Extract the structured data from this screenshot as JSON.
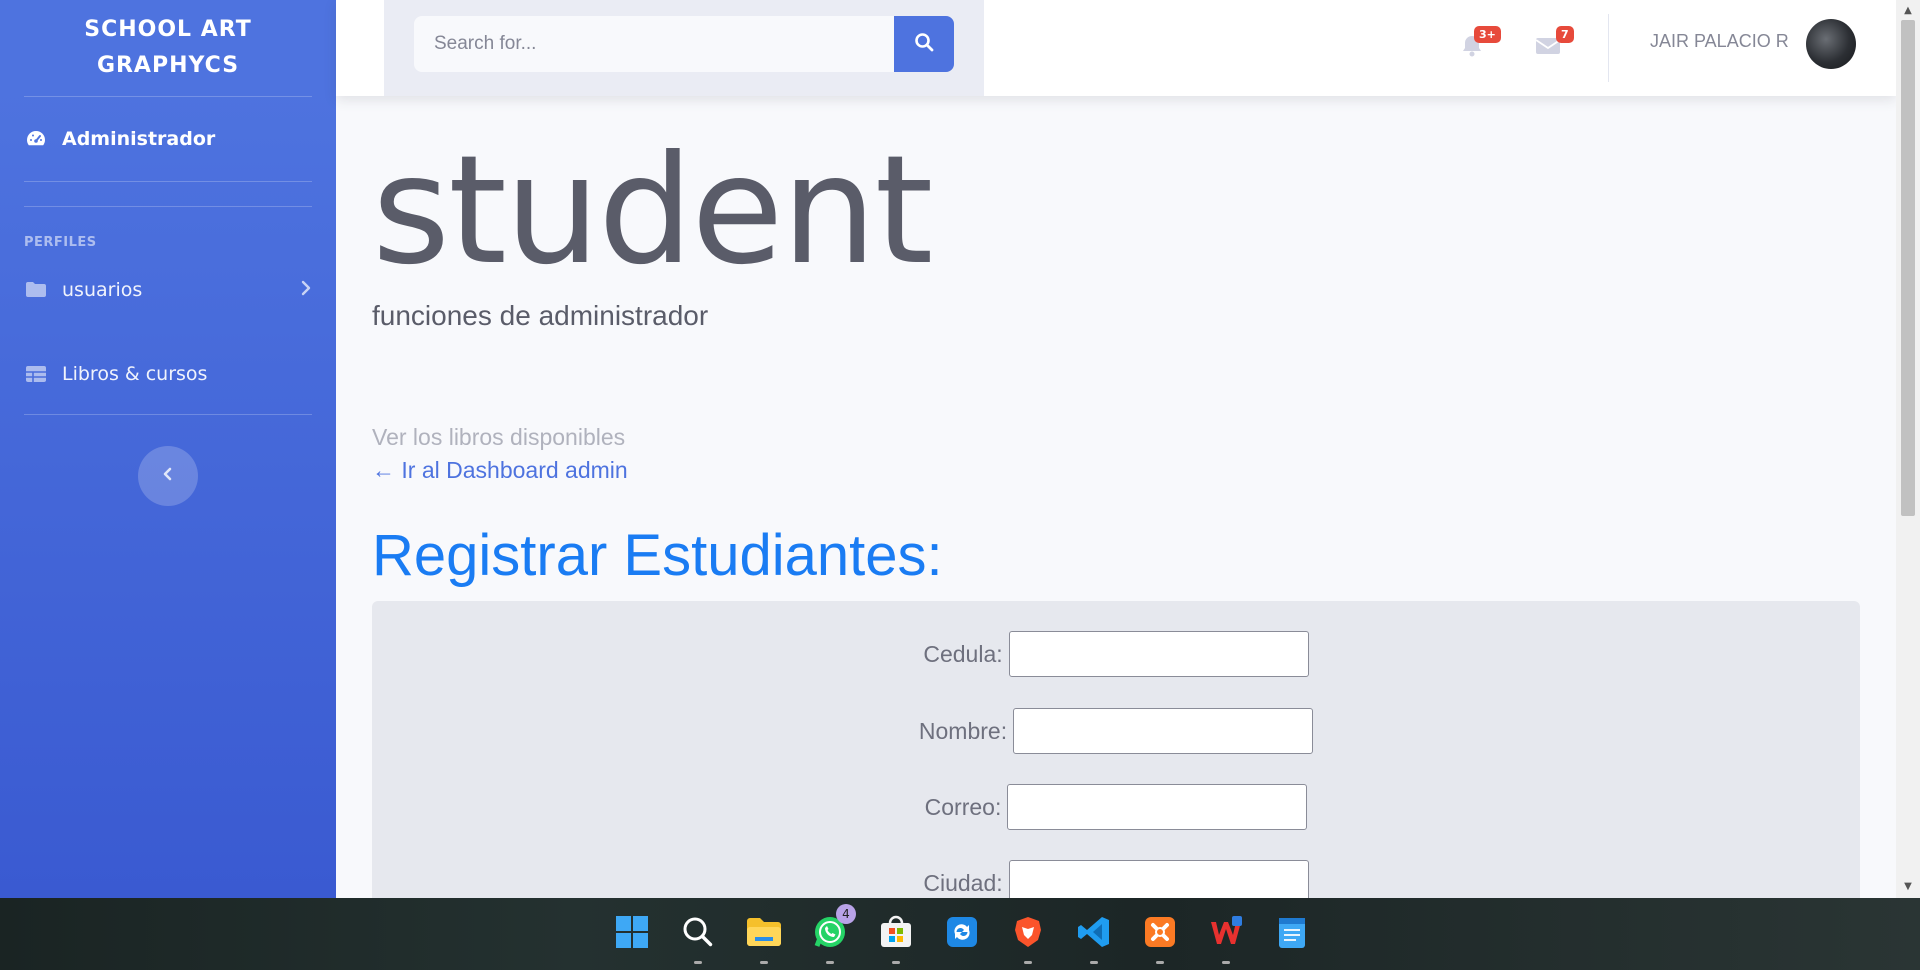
{
  "sidebar": {
    "brand": "SCHOOL ART GRAPHYCS",
    "dashboard_label": "Administrador",
    "heading": "PERFILES",
    "items": [
      {
        "label": "usuarios",
        "icon": "folder-icon"
      },
      {
        "label": "Libros & cursos",
        "icon": "table-icon"
      }
    ]
  },
  "topbar": {
    "search_placeholder": "Search for...",
    "alerts_badge": "3+",
    "messages_badge": "7",
    "user_name": "JAIR PALACIO R"
  },
  "main": {
    "title": "student",
    "subtitle": "funciones de administrador",
    "available_books_link": "Ver los libros disponibles",
    "back_link": "← Ir al Dashboard admin",
    "form_title": "Registrar Estudiantes:",
    "fields": [
      {
        "label": "Cedula:"
      },
      {
        "label": "Nombre:"
      },
      {
        "label": "Correo:"
      },
      {
        "label": "Ciudad:"
      }
    ]
  },
  "taskbar": {
    "whatsapp_badge": "4",
    "apps": [
      "windows-start",
      "search",
      "file-explorer",
      "whatsapp",
      "microsoft-store",
      "sync-app",
      "brave",
      "vscode",
      "xampp",
      "wps-office",
      "notepad"
    ]
  },
  "colors": {
    "primary": "#4e73df",
    "danger": "#e74a3b",
    "title_blue": "#1a7cf3",
    "text_gray": "#5a5c69"
  }
}
